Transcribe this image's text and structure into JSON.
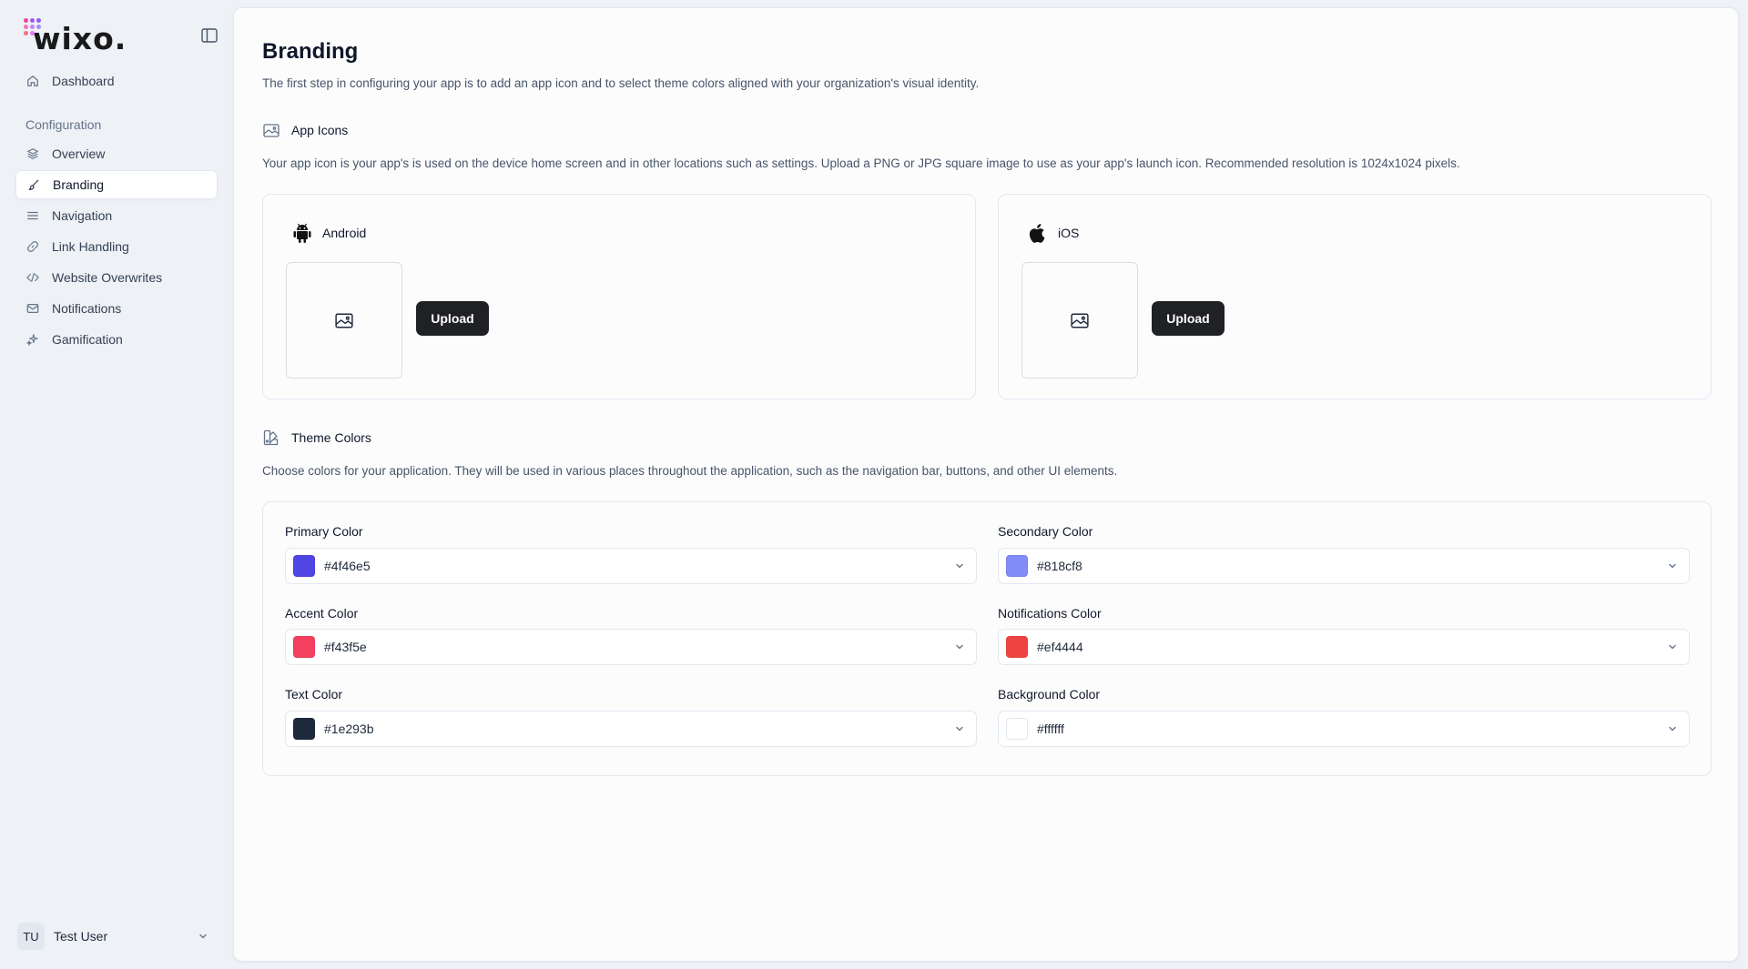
{
  "brand": {
    "logo_text": "wixo."
  },
  "sidebar": {
    "top_item": {
      "label": "Dashboard",
      "icon": "home-icon"
    },
    "section_title": "Configuration",
    "items": [
      {
        "label": "Overview",
        "icon": "layers-icon"
      },
      {
        "label": "Branding",
        "icon": "brush-icon",
        "active": true
      },
      {
        "label": "Navigation",
        "icon": "menu-lines-icon"
      },
      {
        "label": "Link Handling",
        "icon": "link-icon"
      },
      {
        "label": "Website Overwrites",
        "icon": "code-icon"
      },
      {
        "label": "Notifications",
        "icon": "mail-icon"
      },
      {
        "label": "Gamification",
        "icon": "sparkles-icon"
      }
    ],
    "user": {
      "initials": "TU",
      "name": "Test User"
    }
  },
  "page": {
    "title": "Branding",
    "description": "The first step in configuring your app is to add an app icon and to select theme colors aligned with your organization's visual identity."
  },
  "app_icons": {
    "title": "App Icons",
    "description": "Your app icon is your app's is used on the device home screen and in other locations such as settings. Upload a PNG or JPG square image to use as your app's launch icon. Recommended resolution is 1024x1024 pixels.",
    "android": {
      "label": "Android",
      "upload_label": "Upload"
    },
    "ios": {
      "label": "iOS",
      "upload_label": "Upload"
    }
  },
  "theme_colors": {
    "title": "Theme Colors",
    "description": "Choose colors for your application. They will be used in various places throughout the application, such as the navigation bar, buttons, and other UI elements.",
    "primary": {
      "label": "Primary Color",
      "value": "#4f46e5"
    },
    "secondary": {
      "label": "Secondary Color",
      "value": "#818cf8"
    },
    "accent": {
      "label": "Accent Color",
      "value": "#f43f5e"
    },
    "notifications": {
      "label": "Notifications Color",
      "value": "#ef4444"
    },
    "text": {
      "label": "Text Color",
      "value": "#1e293b"
    },
    "background": {
      "label": "Background Color",
      "value": "#ffffff"
    }
  }
}
